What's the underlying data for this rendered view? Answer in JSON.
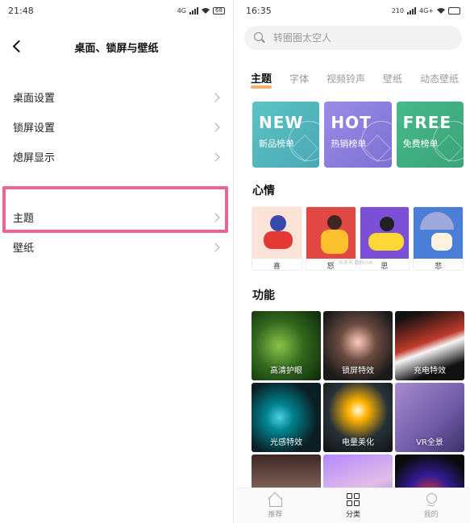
{
  "left": {
    "status": {
      "time": "21:48",
      "network": "4G",
      "battery": "68"
    },
    "title": "桌面、锁屏与壁纸",
    "items": [
      {
        "label": "桌面设置"
      },
      {
        "label": "锁屏设置"
      },
      {
        "label": "熄屏显示"
      },
      {
        "label": "主题"
      },
      {
        "label": "壁纸"
      }
    ]
  },
  "right": {
    "status": {
      "time": "16:35",
      "speed": "210",
      "network": "4G+"
    },
    "search": {
      "placeholder": "转圈圈太空人"
    },
    "tabs": [
      {
        "label": "主题",
        "active": true
      },
      {
        "label": "字体"
      },
      {
        "label": "视频铃声"
      },
      {
        "label": "壁纸"
      },
      {
        "label": "动态壁纸"
      }
    ],
    "banners": [
      {
        "big": "NEW",
        "small": "新品榜单",
        "color": "#5bc4c4"
      },
      {
        "big": "HOT",
        "small": "热销榜单",
        "color": "#9a8ce6"
      },
      {
        "big": "FREE",
        "small": "免费榜单",
        "color": "#47b98a"
      }
    ],
    "mood_title": "心情",
    "moods": [
      {
        "label": "喜"
      },
      {
        "label": "怒"
      },
      {
        "label": "思"
      },
      {
        "label": "悲"
      }
    ],
    "function_title": "功能",
    "functions": [
      {
        "label": "高清护眼"
      },
      {
        "label": "锁屏特效"
      },
      {
        "label": "充电特效"
      },
      {
        "label": "光感特效"
      },
      {
        "label": "电量美化"
      },
      {
        "label": "VR全景"
      },
      {
        "label": ""
      },
      {
        "label": ""
      },
      {
        "label": ""
      }
    ],
    "watermark": "头条号·数码小A",
    "nav": [
      {
        "label": "推荐",
        "icon": "home-icon"
      },
      {
        "label": "分类",
        "icon": "category-icon",
        "active": true
      },
      {
        "label": "我的",
        "icon": "profile-icon"
      }
    ],
    "highlight_color": "#f06292"
  }
}
